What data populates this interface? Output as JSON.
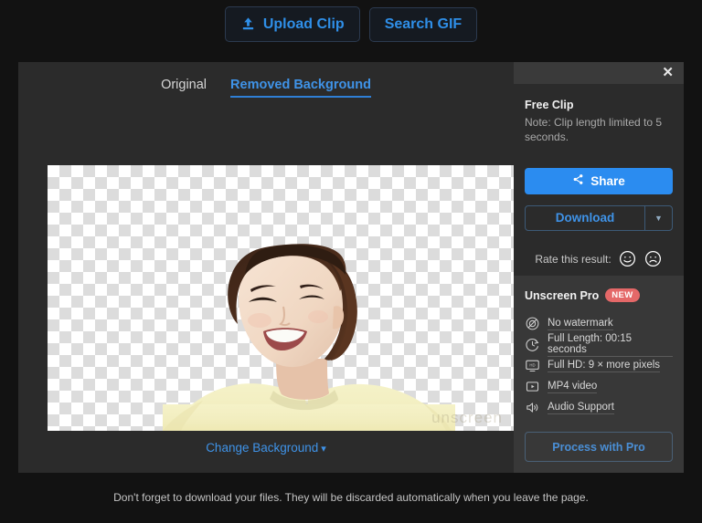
{
  "topbar": {
    "upload_label": "Upload Clip",
    "search_label": "Search GIF",
    "accent": "#2f8fe8"
  },
  "tabs": [
    {
      "label": "Original",
      "active": false
    },
    {
      "label": "Removed Background",
      "active": true
    }
  ],
  "viewer": {
    "watermark": "unscreen",
    "change_background_label": "Change Background",
    "chevron": "❯"
  },
  "sidebar": {
    "close_label": "✕",
    "free": {
      "title": "Free Clip",
      "note": "Note: Clip length limited to 5 seconds."
    },
    "share_label": "Share",
    "download_label": "Download",
    "download_caret": "▼",
    "rate": {
      "label": "Rate this result:",
      "happy_icon": "smiley-happy-icon",
      "sad_icon": "smiley-sad-icon"
    },
    "pro": {
      "title": "Unscreen Pro",
      "badge": "NEW",
      "badge_color": "#e46868",
      "features": [
        {
          "icon": "no-watermark-icon",
          "label": "No watermark"
        },
        {
          "icon": "clock-icon",
          "label": "Full Length: 00:15 seconds"
        },
        {
          "icon": "hd-monitor-icon",
          "label": "Full HD: 9 × more pixels"
        },
        {
          "icon": "video-play-icon",
          "label": "MP4 video"
        },
        {
          "icon": "speaker-icon",
          "label": "Audio Support"
        }
      ],
      "cta_label": "Process with Pro"
    }
  },
  "footer": {
    "text": "Don't forget to download your files. They will be discarded automatically when you leave the page."
  }
}
